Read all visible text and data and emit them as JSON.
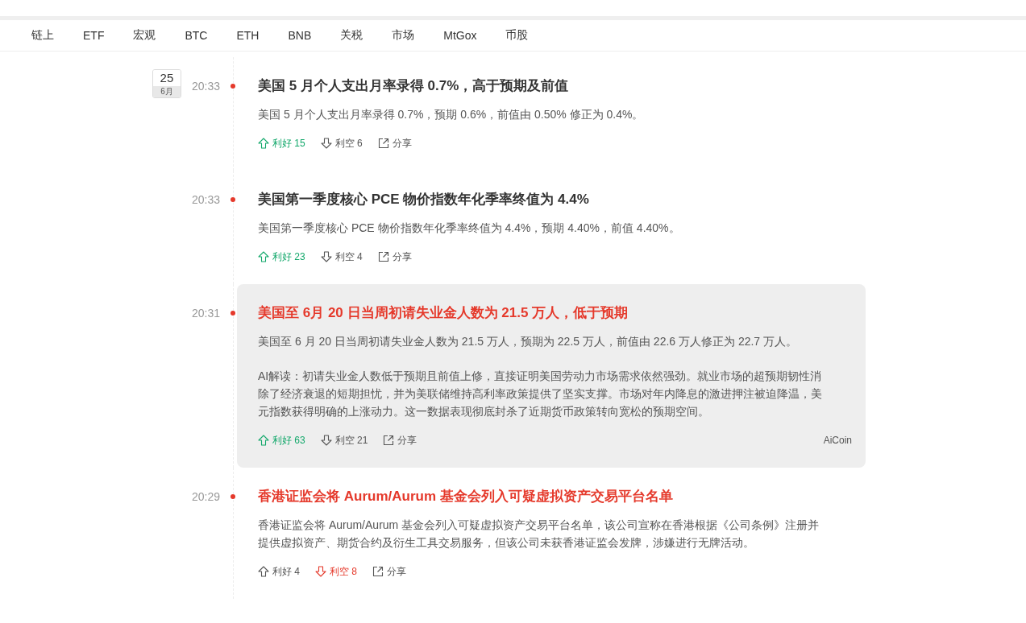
{
  "nav": {
    "tabs": [
      "链上",
      "ETF",
      "宏观",
      "BTC",
      "ETH",
      "BNB",
      "关税",
      "市场",
      "MtGox",
      "币股"
    ]
  },
  "items": [
    {
      "date": {
        "day": "25",
        "month": "6月"
      },
      "time": "20:33",
      "important": false,
      "highlighted": false,
      "title": "美国 5 月个人支出月率录得 0.7%，高于预期及前值",
      "body": "美国 5 月个人支出月率录得 0.7%，预期 0.6%，前值由 0.50% 修正为 0.4%。",
      "bullish": {
        "text": "利好 15",
        "highlighted": true
      },
      "bearish": {
        "text": "利空 6",
        "highlighted": false
      },
      "share": "分享"
    },
    {
      "time": "20:33",
      "important": false,
      "highlighted": false,
      "title": "美国第一季度核心 PCE 物价指数年化季率终值为 4.4%",
      "body": "美国第一季度核心 PCE 物价指数年化季率终值为 4.4%，预期 4.40%，前值 4.40%。",
      "bullish": {
        "text": "利好 23",
        "highlighted": true
      },
      "bearish": {
        "text": "利空 4",
        "highlighted": false
      },
      "share": "分享"
    },
    {
      "time": "20:31",
      "important": true,
      "highlighted": true,
      "title": "美国至 6月 20 日当周初请失业金人数为 21.5 万人，低于预期",
      "body": "美国至 6 月 20 日当周初请失业金人数为 21.5 万人，预期为 22.5 万人，前值由 22.6 万人修正为 22.7 万人。",
      "ai_analysis": "AI解读：初请失业金人数低于预期且前值上修，直接证明美国劳动力市场需求依然强劲。就业市场的超预期韧性消除了经济衰退的短期担忧，并为美联储维持高利率政策提供了坚实支撑。市场对年内降息的激进押注被迫降温，美元指数获得明确的上涨动力。这一数据表现彻底封杀了近期货币政策转向宽松的预期空间。",
      "bullish": {
        "text": "利好 63",
        "highlighted": true
      },
      "bearish": {
        "text": "利空 21",
        "highlighted": false
      },
      "share": "分享",
      "source": "AiCoin"
    },
    {
      "time": "20:29",
      "important": true,
      "highlighted": false,
      "title": "香港证监会将 Aurum/Aurum 基金会列入可疑虚拟资产交易平台名单",
      "body": "香港证监会将 Aurum/Aurum 基金会列入可疑虚拟资产交易平台名单，该公司宣称在香港根据《公司条例》注册并提供虚拟资产、期货合约及衍生工具交易服务，但该公司未获香港证监会发牌，涉嫌进行无牌活动。",
      "bullish": {
        "text": "利好 4",
        "highlighted": false
      },
      "bearish": {
        "text": "利空 8",
        "highlighted": true
      },
      "share": "分享"
    }
  ]
}
